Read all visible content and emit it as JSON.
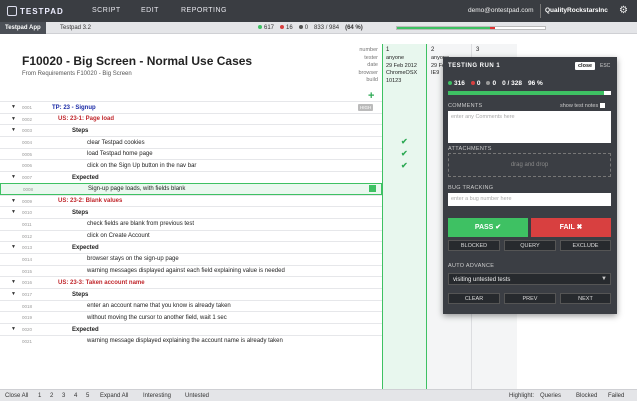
{
  "nav": {
    "logo": "TESTPAD",
    "links": [
      "SCRIPT",
      "EDIT",
      "REPORTING"
    ],
    "email": "demo@ontestpad.com",
    "company": "QualityRockstarsInc"
  },
  "breadcrumb": {
    "app": "Testpad App",
    "script": "Testpad 3.2"
  },
  "stats": {
    "pass": "617",
    "fail": "16",
    "blocked": "0",
    "summary": "833 / 984",
    "percent": "(64 %)"
  },
  "progress": {
    "pass_fraction": 0.63,
    "fail_fraction": 0.03
  },
  "script": {
    "title": "F10020 - Big Screen - Normal Use Cases",
    "subtitle": "From Requirements F10020 - Big Screen",
    "header_labels": [
      "number",
      "tester",
      "date",
      "browser",
      "build"
    ]
  },
  "runs": [
    {
      "number": "1",
      "tester": "anyone",
      "date": "29 Feb 2012",
      "browser": "ChromeOSX",
      "build": "10123"
    },
    {
      "number": "2",
      "tester": "anyone",
      "date": "29 Feb 2012",
      "browser": "IE9",
      "build": ""
    },
    {
      "number": "3",
      "tester": "",
      "date": "",
      "browser": "",
      "build": ""
    }
  ],
  "rows": [
    {
      "ln": "0001",
      "tog": "▼",
      "text": "TP: 23 - Signup",
      "style": "tp"
    },
    {
      "ln": "0002",
      "tog": "▼",
      "text": "US: 23-1: Page load",
      "style": "us"
    },
    {
      "ln": "0003",
      "tog": "▼",
      "text": "Steps",
      "style": "bold"
    },
    {
      "ln": "0004",
      "tog": "",
      "text": "clear Testpad cookies",
      "style": "step"
    },
    {
      "ln": "0005",
      "tog": "",
      "text": "load Testpad home page",
      "style": "step"
    },
    {
      "ln": "0006",
      "tog": "",
      "text": "click on the Sign Up button in the nav bar",
      "style": "step"
    },
    {
      "ln": "0007",
      "tog": "▼",
      "text": "Expected",
      "style": "bold"
    },
    {
      "ln": "0008",
      "tog": "",
      "text": "Sign-up page loads, with fields blank",
      "style": "step"
    },
    {
      "ln": "0009",
      "tog": "▼",
      "text": "US: 23-2: Blank values",
      "style": "us"
    },
    {
      "ln": "0010",
      "tog": "▼",
      "text": "Steps",
      "style": "bold"
    },
    {
      "ln": "0011",
      "tog": "",
      "text": "check fields are blank from previous test",
      "style": "step"
    },
    {
      "ln": "0012",
      "tog": "",
      "text": "click on Create Account",
      "style": "step"
    },
    {
      "ln": "0013",
      "tog": "▼",
      "text": "Expected",
      "style": "bold"
    },
    {
      "ln": "0014",
      "tog": "",
      "text": "browser stays on the sign-up page",
      "style": "step"
    },
    {
      "ln": "0015",
      "tog": "",
      "text": "warning messages displayed against each field explaining value is needed",
      "style": "step"
    },
    {
      "ln": "0016",
      "tog": "▼",
      "text": "US: 23-3: Taken account name",
      "style": "us"
    },
    {
      "ln": "0017",
      "tog": "▼",
      "text": "Steps",
      "style": "bold"
    },
    {
      "ln": "0018",
      "tog": "",
      "text": "enter an account name that you know is already taken",
      "style": "step"
    },
    {
      "ln": "0019",
      "tog": "",
      "text": "without moving the cursor to another field, wait 1 sec",
      "style": "step"
    },
    {
      "ln": "0020",
      "tog": "▼",
      "text": "Expected",
      "style": "bold"
    },
    {
      "ln": "0021",
      "tog": "",
      "text": "warning message displayed explaining the account name is already taken",
      "style": "step"
    }
  ],
  "new_badge": "HIGH",
  "panel": {
    "title": "TESTING RUN 1",
    "close": "close",
    "esc": "ESC",
    "pass": "316",
    "fail": "0",
    "blocked": "0",
    "summary": "0 / 328",
    "percent": "96 %",
    "pass_fraction": 0.96,
    "comments_label": "COMMENTS",
    "show_notes": "show test notes",
    "comments_placeholder": "enter any Comments here",
    "attachments_label": "ATTACHMENTS",
    "drop_text": "drag and drop",
    "bug_label": "BUG TRACKING",
    "bug_placeholder": "enter a bug number here",
    "pass_btn": "PASS ✔",
    "fail_btn": "FAIL ✖",
    "blocked_btn": "BLOCKED",
    "query_btn": "QUERY",
    "exclude_btn": "EXCLUDE",
    "auto_label": "AUTO ADVANCE",
    "auto_value": "visiting untested tests",
    "clear_btn": "CLEAR",
    "prev_btn": "PREV",
    "next_btn": "NEXT"
  },
  "bottom": {
    "close_all": "Close All",
    "levels": [
      "1",
      "2",
      "3",
      "4",
      "5"
    ],
    "expand_all": "Expand All",
    "interesting": "Interesting",
    "untested": "Untested",
    "highlight": "Highlight:",
    "queries": "Queries",
    "blocked": "Blocked",
    "failed": "Failed"
  },
  "colors": {
    "pass": "#3ec163",
    "fail": "#d84040",
    "nav": "#3a3d42",
    "link_red": "#c0282d",
    "link_blue": "#1a2aa6"
  }
}
